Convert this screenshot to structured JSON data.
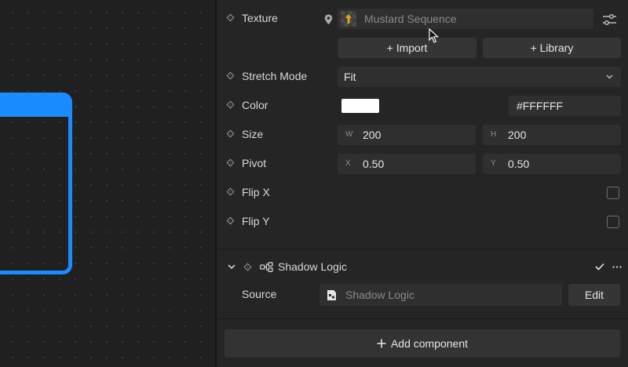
{
  "texture": {
    "label": "Texture",
    "value": "Mustard Sequence"
  },
  "buttons": {
    "import": "+ Import",
    "library": "+ Library"
  },
  "stretch_mode": {
    "label": "Stretch Mode",
    "value": "Fit"
  },
  "color": {
    "label": "Color",
    "hex": "#FFFFFF",
    "swatch": "#FFFFFF"
  },
  "size": {
    "label": "Size",
    "w_axis": "W",
    "w": "200",
    "h_axis": "H",
    "h": "200"
  },
  "pivot": {
    "label": "Pivot",
    "x_axis": "X",
    "x": "0.50",
    "y_axis": "Y",
    "y": "0.50"
  },
  "flip_x": {
    "label": "Flip X",
    "checked": false
  },
  "flip_y": {
    "label": "Flip Y",
    "checked": false
  },
  "shadow_logic": {
    "title": "Shadow Logic",
    "enabled": true,
    "source_label": "Source",
    "source_value": "Shadow Logic",
    "edit_label": "Edit"
  },
  "add_component": {
    "label": "Add component"
  },
  "colors": {
    "accent": "#1a8cff",
    "panel": "#252525",
    "field": "#2f2f2f"
  }
}
